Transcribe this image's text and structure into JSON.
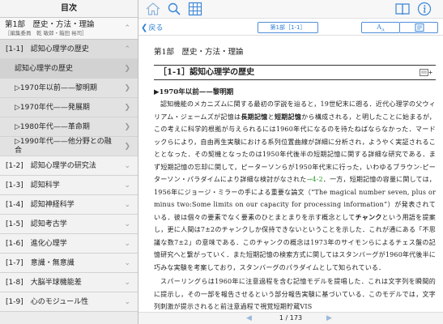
{
  "sidebar": {
    "title": "目次",
    "part_title": "第1部　歴史・方法・理論",
    "part_editors": "［編集委員　乾 敏郎・箱田 裕司］",
    "items": [
      {
        "label": "[1-1]　認知心理学の歴史",
        "type": "sec",
        "open": true
      },
      {
        "label": "認知心理学の歴史",
        "type": "sub"
      },
      {
        "label": "▷1970年以前——黎明期",
        "type": "sub"
      },
      {
        "label": "▷1970年代——発展期",
        "type": "sub"
      },
      {
        "label": "▷1980年代——革命期",
        "type": "sub"
      },
      {
        "label": "▷1990年代——他分野との融合",
        "type": "sub2"
      },
      {
        "label": "[1-2]　認知心理学の研究法",
        "type": "sec"
      },
      {
        "label": "[1-3]　認知科学",
        "type": "sec"
      },
      {
        "label": "[1-4]　認知神経科学",
        "type": "sec"
      },
      {
        "label": "[1-5]　認知考古学",
        "type": "sec"
      },
      {
        "label": "[1-6]　進化心理学",
        "type": "sec"
      },
      {
        "label": "[1-7]　意識・無意識",
        "type": "sec"
      },
      {
        "label": "[1-8]　大脳半球機能差",
        "type": "sec"
      },
      {
        "label": "[1-9]　心のモジュール性",
        "type": "sec"
      }
    ]
  },
  "navbar": {
    "back_label": "戻る",
    "section_label": "第1部［1-1］",
    "font_label": "A",
    "font_sub": "A"
  },
  "content": {
    "breadcrumb": "第1部　歴史・方法・理論",
    "heading": "［1-1］認知心理学の歴史",
    "subheading": "▶1970年以前——黎明期",
    "p1_a": "認知機能のメカニズムに関する最初の学説を辿ると，19世紀末に遡る．近代心理学の父ウィリアム・ジェームズが記憶は",
    "p1_b1": "長期記憶",
    "p1_c": "と",
    "p1_b2": "短期記憶",
    "p1_d": "から構成される，と明したことに始まるが，この考えに科学的根拠が与えられるには1960年代になるのを待たねばならなかった．マードックらにより，自由再生実験における系列位置曲線が詳細に分析され，ようやく実証されることとなった．その契機となったのは1950年代後半の短期記憶に関する詳細な研究である．まず短期記憶の忘却に関して，ピーターソンらが1950年代末に行った，いわゆるブラウン-ピーターソン・パラダイムにより詳細な検討がなされた",
    "p1_link": "→4-2",
    "p1_e": "．一方，短期記憶の容量に関しては，1956年にジョージ・ミラーの手による重要な論文（“The magical number seven, plus or minus two:Some limits on our capacity for processing information”）が発表されている．彼は個々の要素でなく要素のひとまとまりを示す概念として",
    "p1_b3": "チャンク",
    "p1_f": "という用語を提案し，更に人間は7±2のチャンクしか保持できないということを示した．これが通にある「不思議な数7±2」の意味である．このチャンクの概念は1973年のサイモンらによるチェス盤の記憶研究へと繋がっていく．また短期記憶の検索方式に関してはスタンバーグが1960年代後半に巧みな実験を考案しており，スタンバーグのパラダイムとして知られている．",
    "p2": "スパーリングらは1960年に注意過程を含む記憶モデルを提唱した．これは文字列を瞬間的に提示し，その一部を報告させるという部分報告実験に基づいている．このモデルでは，文字列刺激が提示されると前注意過程で視覚短期貯蔵VIS"
  },
  "pager": {
    "current": "1",
    "total": "173",
    "sep": " / "
  }
}
